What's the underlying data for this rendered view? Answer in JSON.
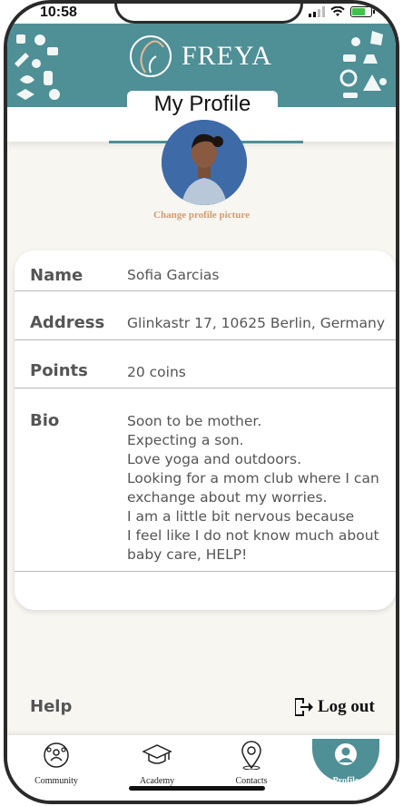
{
  "status": {
    "time": "10:58"
  },
  "header": {
    "brand": "FREYA",
    "page_title": "My Profile"
  },
  "profile": {
    "change_picture_label": "Change profile picture",
    "fields": [
      {
        "label": "Name",
        "value": "Sofia Garcias"
      },
      {
        "label": "Address",
        "value": "Glinkastr 17, 10625 Berlin, Germany"
      },
      {
        "label": "Points",
        "value": "20 coins"
      },
      {
        "label": "Bio",
        "value": "Soon to be mother.\nExpecting a son.\nLove yoga and outdoors.\nLooking for a mom club where I can\nexchange about my worries.\nI am a little bit nervous because\nI feel like I do not know much about\nbaby care, HELP!"
      }
    ]
  },
  "footer": {
    "help_label": "Help",
    "logout_label": "Log out"
  },
  "tabs": [
    {
      "label": "Community",
      "icon": "community-icon"
    },
    {
      "label": "Academy",
      "icon": "graduation-cap-icon"
    },
    {
      "label": "Contacts",
      "icon": "location-pin-icon"
    },
    {
      "label": "Profile",
      "icon": "profile-icon",
      "active": true
    }
  ],
  "colors": {
    "brand_teal": "#4f8f96",
    "accent_peach": "#d49a6f"
  }
}
